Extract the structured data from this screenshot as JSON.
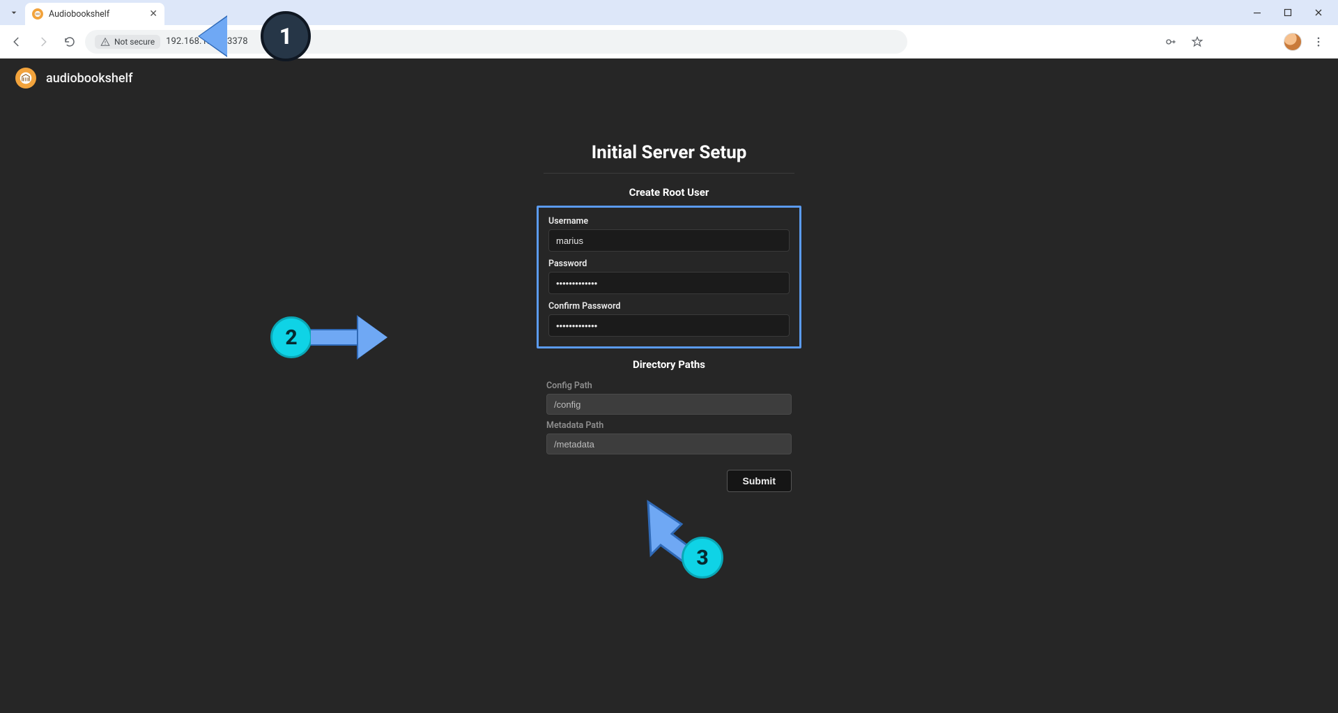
{
  "browser": {
    "tab_title": "Audiobookshelf",
    "not_secure_label": "Not secure",
    "url": "192.168.1.18:13378"
  },
  "app": {
    "name": "audiobookshelf"
  },
  "setup": {
    "title": "Initial Server Setup",
    "create_root_user": "Create Root User",
    "username_label": "Username",
    "username_value": "marius",
    "password_label": "Password",
    "password_value": "•••••••••••••",
    "confirm_password_label": "Confirm Password",
    "confirm_password_value": "•••••••••••••",
    "directory_paths": "Directory Paths",
    "config_path_label": "Config Path",
    "config_path_value": "/config",
    "metadata_path_label": "Metadata Path",
    "metadata_path_value": "/metadata",
    "submit_label": "Submit"
  },
  "annotations": {
    "one": "1",
    "two": "2",
    "three": "3"
  }
}
